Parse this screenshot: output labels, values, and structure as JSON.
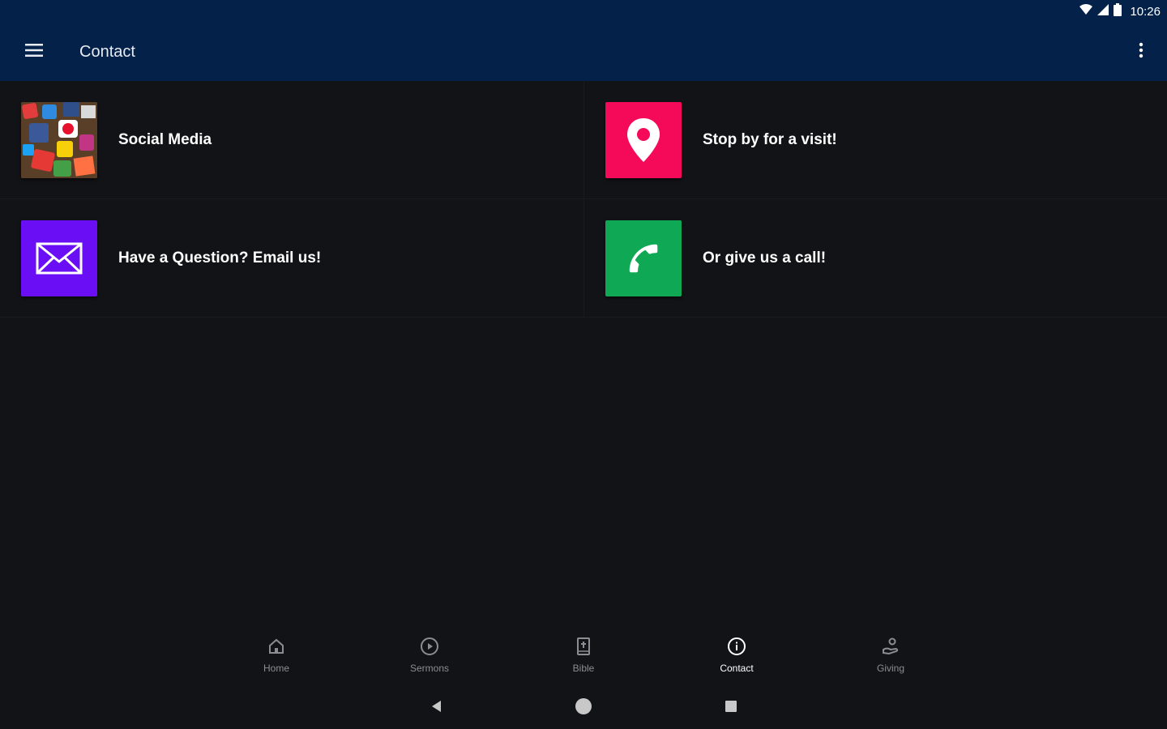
{
  "status_bar": {
    "time": "10:26",
    "icons": [
      "wifi-icon",
      "signal-icon",
      "battery-icon"
    ]
  },
  "header": {
    "title": "Contact",
    "menu_icon": "hamburger-menu-icon",
    "overflow_icon": "more-vert-icon"
  },
  "colors": {
    "header_bg": "#032149",
    "page_bg": "#121316",
    "visit": "#f50a5a",
    "email": "#6a0ff5",
    "call": "#0fa855"
  },
  "tiles": [
    {
      "label": "Social Media",
      "icon": "social-media-collage-icon"
    },
    {
      "label": "Stop by for a visit!",
      "icon": "location-pin-icon"
    },
    {
      "label": "Have a Question? Email us!",
      "icon": "envelope-icon"
    },
    {
      "label": "Or give us a call!",
      "icon": "phone-icon"
    }
  ],
  "bottom_nav": [
    {
      "label": "Home",
      "icon": "home-icon"
    },
    {
      "label": "Sermons",
      "icon": "play-circle-icon"
    },
    {
      "label": "Bible",
      "icon": "bible-icon"
    },
    {
      "label": "Contact",
      "icon": "info-icon",
      "active": true
    },
    {
      "label": "Giving",
      "icon": "giving-hand-icon"
    }
  ],
  "system_nav": [
    "back-icon",
    "home-circle-icon",
    "recents-icon"
  ]
}
